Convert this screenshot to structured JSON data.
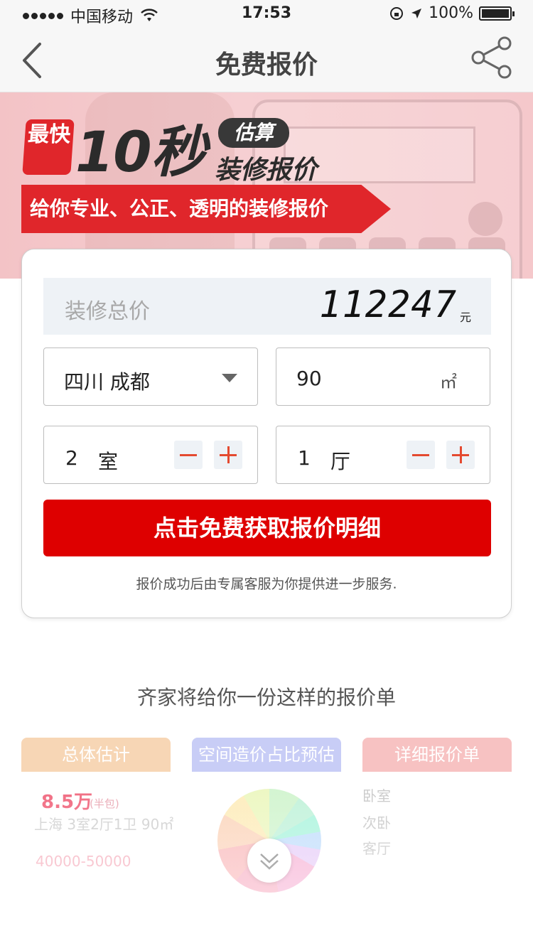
{
  "status_bar": {
    "carrier": "中国移动",
    "time": "17:53",
    "battery": "100%"
  },
  "nav": {
    "title": "免费报价"
  },
  "banner": {
    "badge": "最快",
    "headline": "10秒",
    "estimate_tag": "估算",
    "estimate_sub": "装修报价",
    "ribbon": "给你专业、公正、透明的装修报价"
  },
  "form": {
    "total_label": "装修总价",
    "total_value": "112247",
    "total_unit": "元",
    "city_value": "四川 成都",
    "area_value": "90",
    "area_unit": "㎡",
    "rooms": {
      "value": "2",
      "unit": "室"
    },
    "halls": {
      "value": "1",
      "unit": "厅"
    },
    "cta_label": "点击免费获取报价明细",
    "note": "报价成功后由专属客服为你提供进一步服务."
  },
  "sample": {
    "title": "齐家将给你一份这样的报价单",
    "columns": [
      "总体估计",
      "空间造价占比预估",
      "详细报价单"
    ],
    "summary": {
      "price": "8.5万",
      "price_note": "(半包)",
      "location": "上海 3室2厅1卫 90㎡",
      "range": "40000-50000"
    },
    "detail_items": [
      "卧室",
      "次卧",
      "客厅"
    ]
  },
  "icons": {
    "back": "chevron-left-icon",
    "share": "share-icon",
    "dropdown": "caret-down-icon",
    "expand": "double-chevron-down-icon"
  },
  "colors": {
    "brand_red": "#de0000",
    "accent_red": "#e0262b",
    "stepper_red": "#e44a30",
    "banner_pink": "#f5c8cb"
  }
}
